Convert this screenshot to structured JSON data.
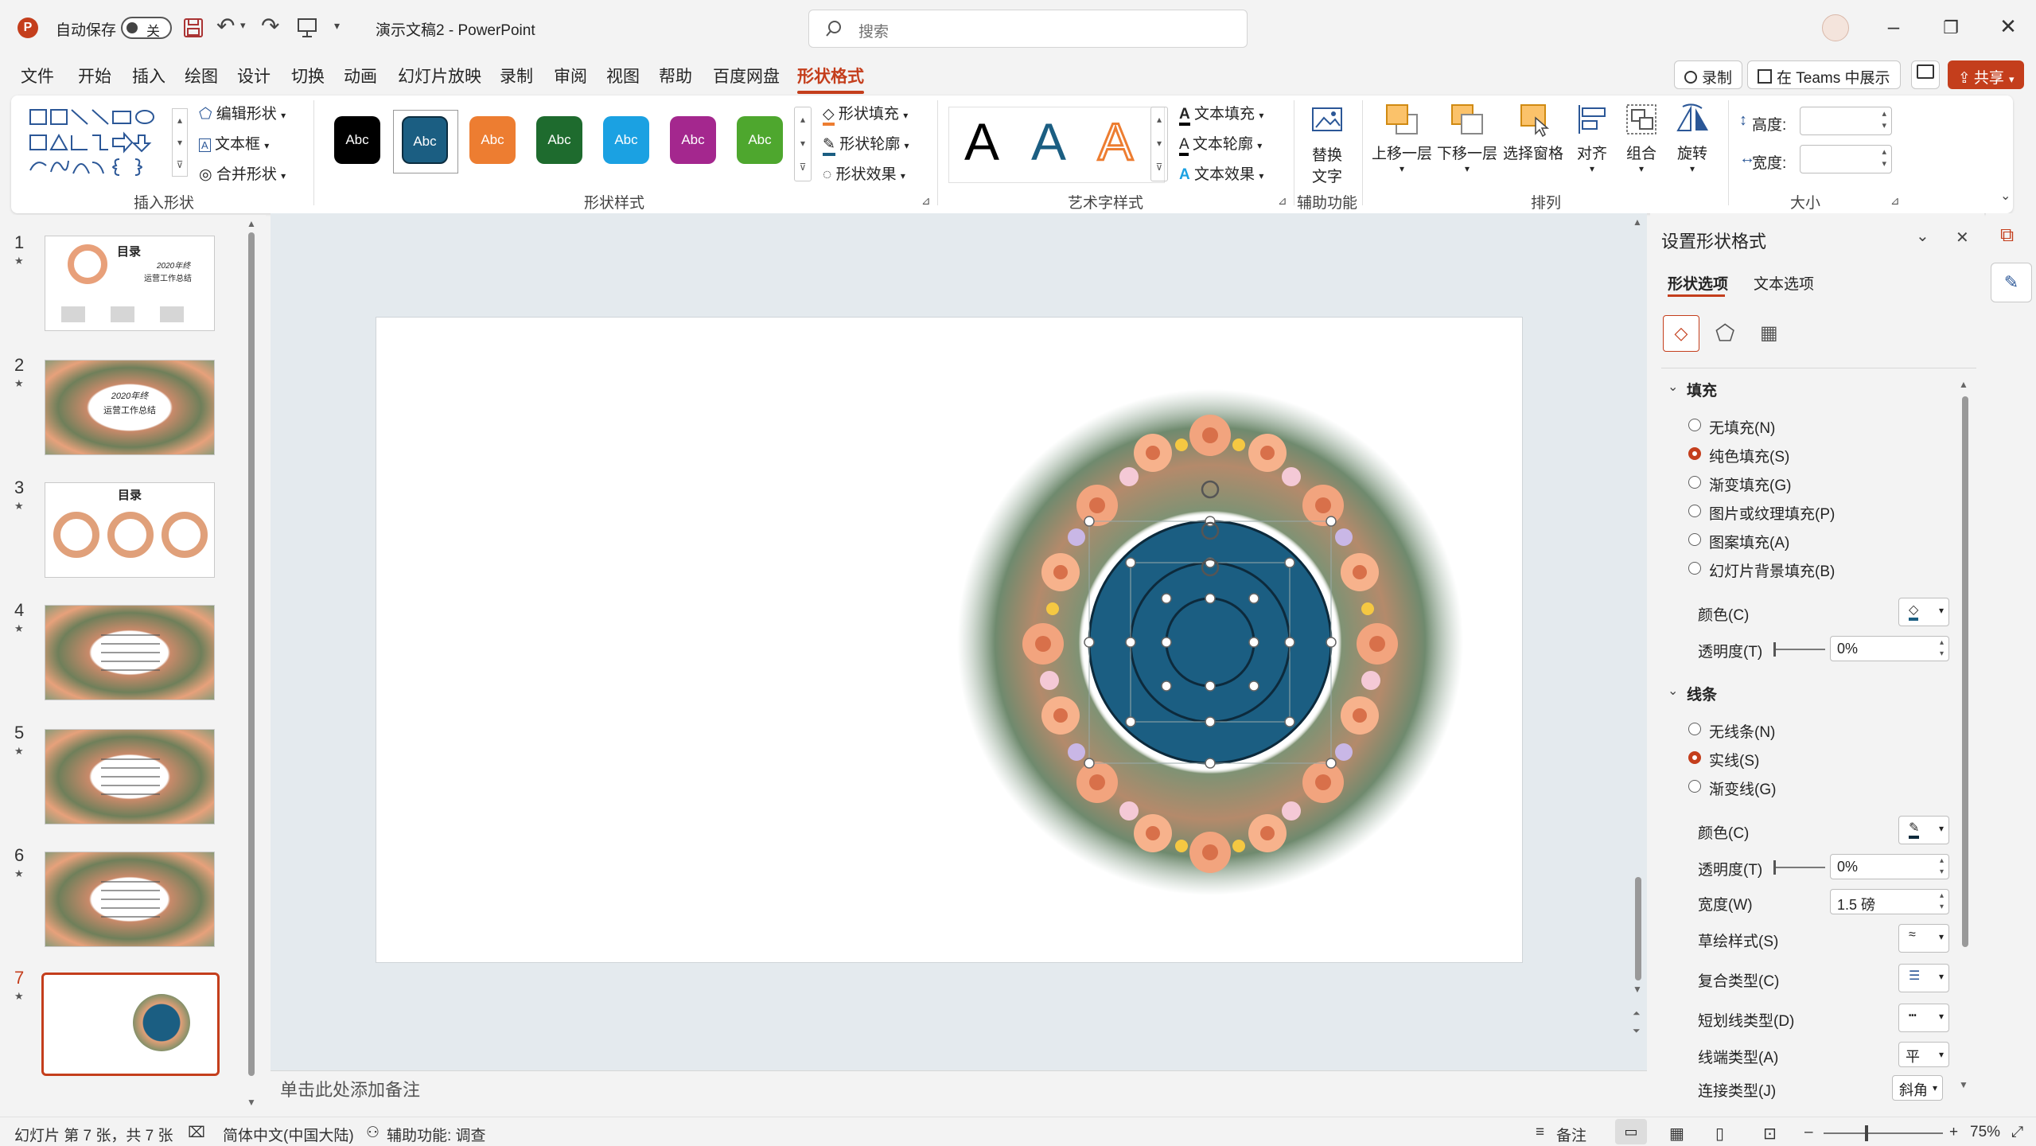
{
  "titlebar": {
    "autosave_label": "自动保存",
    "autosave_state": "关",
    "doc_title": "演示文稿2  -  PowerPoint",
    "search_placeholder": "搜索"
  },
  "menu": {
    "tabs": [
      "文件",
      "开始",
      "插入",
      "绘图",
      "设计",
      "切换",
      "动画",
      "幻灯片放映",
      "录制",
      "审阅",
      "视图",
      "帮助",
      "百度网盘",
      "形状格式"
    ],
    "active_tab": "形状格式",
    "record_label": "录制",
    "teams_label": "在 Teams 中展示",
    "share_label": "共享"
  },
  "ribbon": {
    "insert_shape": {
      "edit_shape": "编辑形状",
      "text_box": "文本框",
      "merge_shapes": "合并形状",
      "group_label": "插入形状"
    },
    "shape_styles": {
      "swatch_text": "Abc",
      "swatches": [
        "#000000",
        "#1b5e82",
        "#ed7d31",
        "#1e6b2e",
        "#1ba1e2",
        "#a4278e",
        "#4ea72e"
      ],
      "fill": "形状填充",
      "outline": "形状轮廓",
      "effects": "形状效果",
      "group_label": "形状样式"
    },
    "wordart": {
      "letter": "A",
      "text_fill": "文本填充",
      "text_outline": "文本轮廓",
      "text_effects": "文本效果",
      "group_label": "艺术字样式"
    },
    "accessibility": {
      "alt_text_line1": "替换",
      "alt_text_line2": "文字",
      "group_label": "辅助功能"
    },
    "arrange": {
      "bring_forward": "上移一层",
      "send_backward": "下移一层",
      "selection_pane": "选择窗格",
      "align": "对齐",
      "group": "组合",
      "rotate": "旋转",
      "group_label": "排列"
    },
    "size": {
      "height_label": "高度:",
      "width_label": "宽度:",
      "group_label": "大小"
    }
  },
  "slides": {
    "numbers": [
      "1",
      "2",
      "3",
      "4",
      "5",
      "6",
      "7"
    ],
    "selected": "7",
    "thumb_texts": {
      "s1_title": "目录",
      "s1_sub1": "2020年终",
      "s1_sub2": "运营工作总结",
      "s2_line1": "2020年终",
      "s2_line2": "运营工作总结",
      "s3_title": "目录"
    }
  },
  "notes": {
    "placeholder": "单击此处添加备注"
  },
  "format_pane": {
    "title": "设置形状格式",
    "tabs": [
      "形状选项",
      "文本选项"
    ],
    "fill_section": "填充",
    "fill_options": [
      "无填充(N)",
      "纯色填充(S)",
      "渐变填充(G)",
      "图片或纹理填充(P)",
      "图案填充(A)",
      "幻灯片背景填充(B)"
    ],
    "fill_selected": "纯色填充(S)",
    "fill_color_label": "颜色(C)",
    "fill_transparency_label": "透明度(T)",
    "fill_transparency_value": "0%",
    "line_section": "线条",
    "line_options": [
      "无线条(N)",
      "实线(S)",
      "渐变线(G)"
    ],
    "line_selected": "实线(S)",
    "line_color_label": "颜色(C)",
    "line_transparency_label": "透明度(T)",
    "line_transparency_value": "0%",
    "width_label": "宽度(W)",
    "width_value": "1.5 磅",
    "sketch_label": "草绘样式(S)",
    "compound_label": "复合类型(C)",
    "dash_label": "短划线类型(D)",
    "cap_label": "线端类型(A)",
    "cap_value": "平",
    "join_label": "连接类型(J)",
    "join_value": "斜角"
  },
  "statusbar": {
    "slide_info": "幻灯片 第 7 张，共 7 张",
    "language": "简体中文(中国大陆)",
    "accessibility": "辅助功能: 调查",
    "notes_btn": "备注",
    "zoom": "75%"
  },
  "colors": {
    "accent": "#c43e1c",
    "circle_fill": "#1b5e82"
  }
}
